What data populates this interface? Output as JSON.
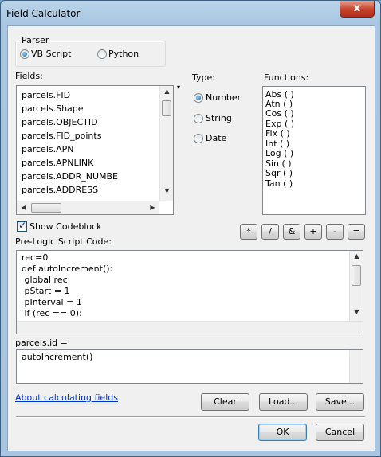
{
  "window": {
    "title": "Field Calculator",
    "close_glyph": "x"
  },
  "parser": {
    "label": "Parser",
    "options": [
      {
        "label": "VB Script",
        "selected": true
      },
      {
        "label": "Python",
        "selected": false
      }
    ]
  },
  "fields": {
    "label": "Fields:",
    "items": [
      "parcels.FID",
      "parcels.Shape",
      "parcels.OBJECTID",
      "parcels.FID_points",
      "parcels.APN",
      "parcels.APNLINK",
      "parcels.ADDR_NUMBE",
      "parcels.ADDRESS"
    ]
  },
  "type": {
    "label": "Type:",
    "options": [
      {
        "label": "Number",
        "selected": true
      },
      {
        "label": "String",
        "selected": false
      },
      {
        "label": "Date",
        "selected": false
      }
    ]
  },
  "functions": {
    "label": "Functions:",
    "items": [
      "Abs ( )",
      "Atn ( )",
      "Cos ( )",
      "Exp ( )",
      "Fix ( )",
      "Int ( )",
      "Log ( )",
      "Sin ( )",
      "Sqr ( )",
      "Tan ( )"
    ]
  },
  "show_codeblock": {
    "label": "Show Codeblock",
    "checked": true
  },
  "operators": [
    "*",
    "/",
    "&",
    "+",
    "-",
    "="
  ],
  "prelogic": {
    "label": "Pre-Logic Script Code:",
    "lines": [
      "rec=0",
      "def autoIncrement():",
      " global rec",
      " pStart = 1",
      " pInterval = 1",
      " if (rec == 0):"
    ]
  },
  "expression": {
    "label": "parcels.id =",
    "value": "autoIncrement()"
  },
  "help_link": "About calculating fields",
  "buttons": {
    "clear": "Clear",
    "load": "Load...",
    "save": "Save...",
    "ok": "OK",
    "cancel": "Cancel"
  },
  "icons": {
    "close": "close-icon",
    "radio": "radio-icon",
    "checkbox": "checkbox-icon",
    "scroll_up": "scroll-up-icon",
    "scroll_down": "scroll-down-icon",
    "scroll_left": "scroll-left-icon",
    "scroll_right": "scroll-right-icon"
  }
}
